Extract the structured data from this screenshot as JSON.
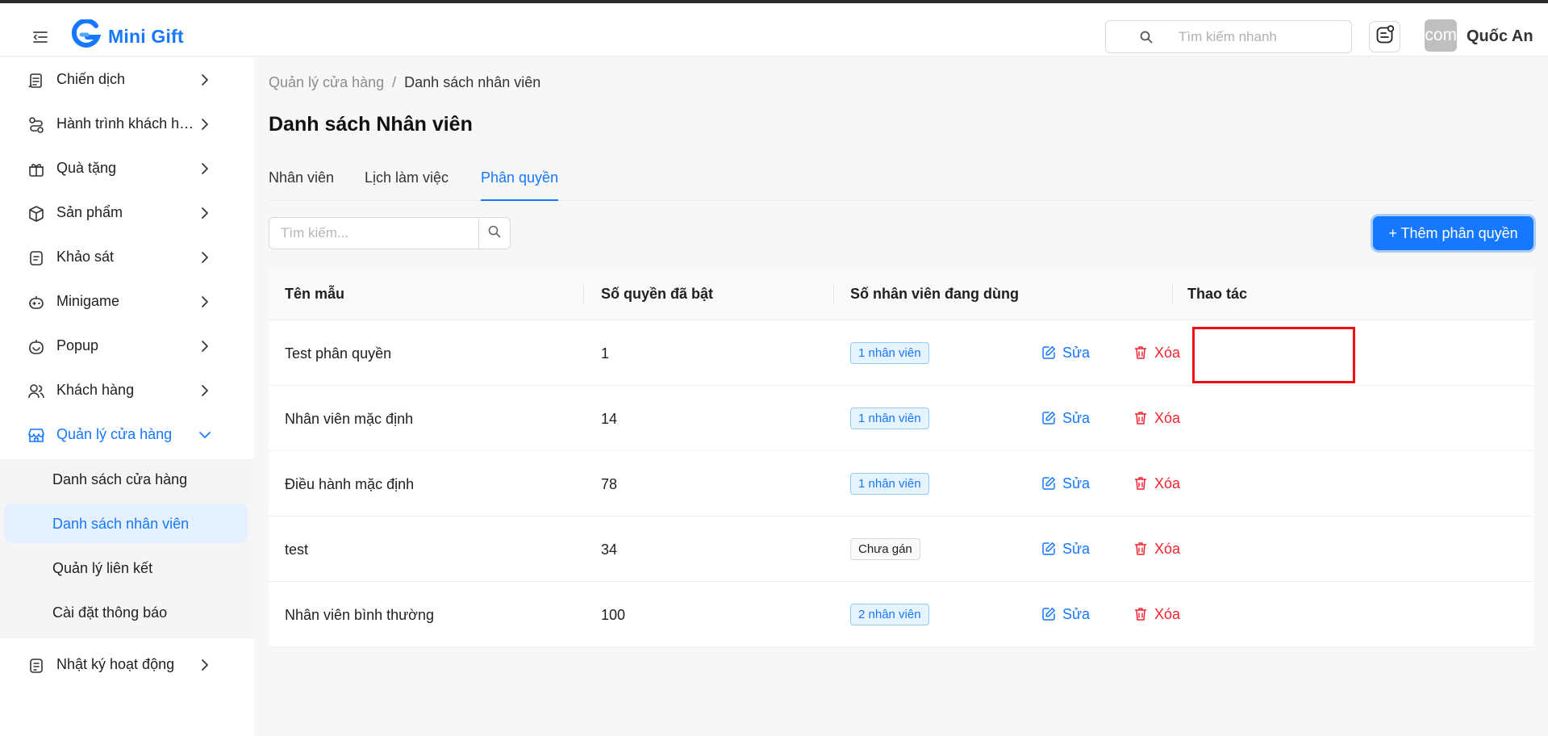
{
  "header": {
    "brand": "Mini Gift",
    "quick_search_placeholder": "Tìm kiếm nhanh",
    "avatar_text": "com",
    "user_name": "Quốc An"
  },
  "sidebar": {
    "items": [
      {
        "label": "Chiến dịch",
        "icon": "campaign-icon"
      },
      {
        "label": "Hành trình khách hàng",
        "icon": "journey-icon"
      },
      {
        "label": "Quà tặng",
        "icon": "gift-icon"
      },
      {
        "label": "Sản phẩm",
        "icon": "box-icon"
      },
      {
        "label": "Khảo sát",
        "icon": "survey-icon"
      },
      {
        "label": "Minigame",
        "icon": "game-icon"
      },
      {
        "label": "Popup",
        "icon": "popup-icon"
      },
      {
        "label": "Khách hàng",
        "icon": "users-icon"
      },
      {
        "label": "Quản lý cửa hàng",
        "icon": "store-icon"
      },
      {
        "label": "Nhật ký hoạt động",
        "icon": "log-icon"
      }
    ],
    "submenu": [
      {
        "label": "Danh sách cửa hàng"
      },
      {
        "label": "Danh sách nhân viên"
      },
      {
        "label": "Quản lý liên kết"
      },
      {
        "label": "Cài đặt thông báo"
      }
    ]
  },
  "breadcrumb": {
    "parent": "Quản lý cửa hàng",
    "separator": "/",
    "current": "Danh sách nhân viên"
  },
  "page_title": "Danh sách Nhân viên",
  "tabs": [
    {
      "label": "Nhân viên"
    },
    {
      "label": "Lịch làm việc"
    },
    {
      "label": "Phân quyền"
    }
  ],
  "search_placeholder": "Tìm kiếm...",
  "add_button": "+ Thêm phân quyền",
  "table": {
    "headers": [
      "Tên mẫu",
      "Số quyền đã bật",
      "Số nhân viên đang dùng",
      "Thao tác"
    ],
    "rows": [
      {
        "name": "Test phân quyền",
        "count": "1",
        "tag": "1 nhân viên",
        "tag_type": "blue"
      },
      {
        "name": "Nhân viên mặc định",
        "count": "14",
        "tag": "1 nhân viên",
        "tag_type": "blue"
      },
      {
        "name": "Điều hành mặc định",
        "count": "78",
        "tag": "1 nhân viên",
        "tag_type": "blue"
      },
      {
        "name": "test",
        "count": "34",
        "tag": "Chưa gán",
        "tag_type": "gray"
      },
      {
        "name": "Nhân viên bình thường",
        "count": "100",
        "tag": "2 nhân viên",
        "tag_type": "blue"
      }
    ],
    "edit_label": "Sửa",
    "delete_label": "Xóa"
  },
  "colors": {
    "primary": "#1677ff",
    "danger": "#f5222d",
    "highlight": "#f01010"
  }
}
